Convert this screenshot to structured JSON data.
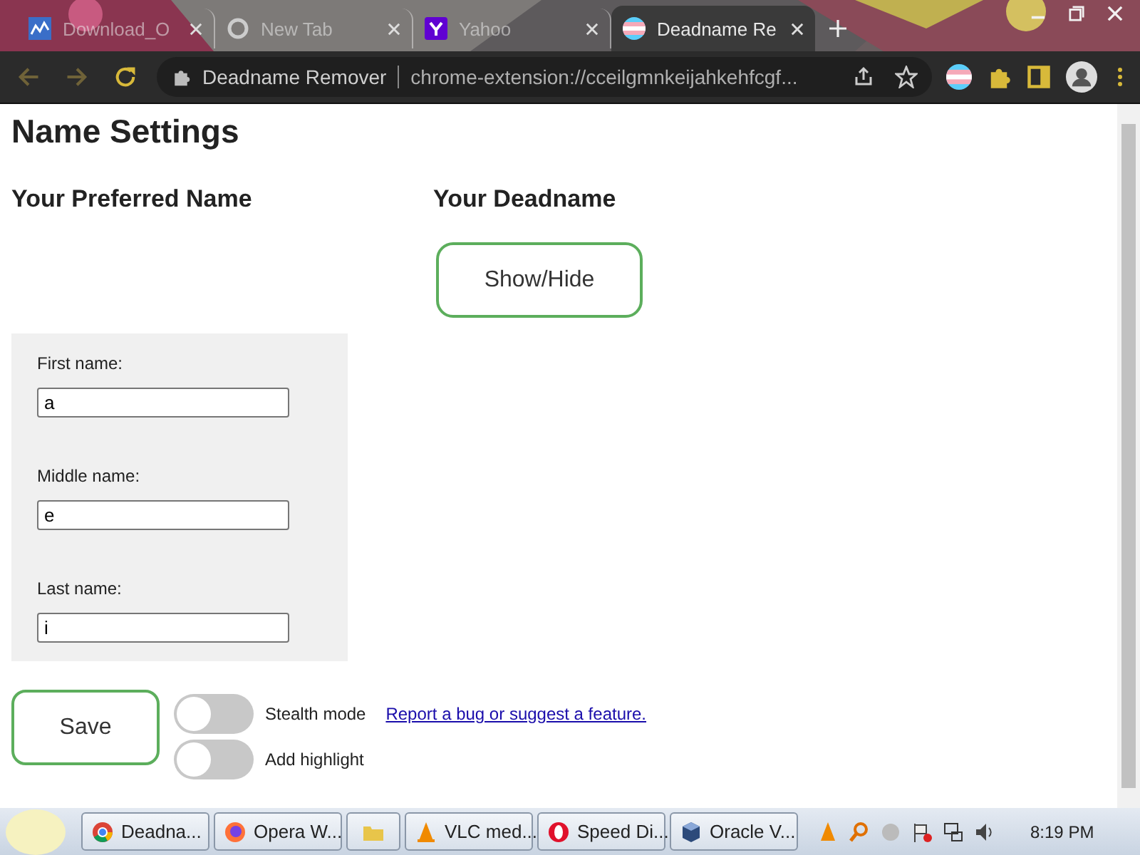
{
  "browser": {
    "tabs": [
      {
        "title": "Download_O",
        "kind": "chart",
        "selected": false
      },
      {
        "title": "New Tab",
        "kind": "google",
        "selected": false
      },
      {
        "title": "Yahoo",
        "kind": "yahoo",
        "selected": false
      },
      {
        "title": "Deadname Re",
        "kind": "flag",
        "selected": true
      }
    ],
    "site_name": "Deadname Remover",
    "url": "chrome-extension://cceilgmnkeijahkehfcgf..."
  },
  "page": {
    "title": "Name Settings",
    "preferred_heading": "Your Preferred Name",
    "deadname_heading": "Your Deadname",
    "show_hide_button": "Show/Hide",
    "fields": [
      {
        "label": "First name:",
        "value": "a"
      },
      {
        "label": "Middle name:",
        "value": "e"
      },
      {
        "label": "Last name:",
        "value": "i"
      }
    ],
    "save_button": "Save",
    "toggles": [
      {
        "label": "Stealth mode",
        "on": false
      },
      {
        "label": "Add highlight",
        "on": false
      }
    ],
    "report_link": "Report a bug or suggest a feature."
  },
  "taskbar": {
    "items": [
      {
        "label": "Deadna...",
        "kind": "chrome"
      },
      {
        "label": "Opera W...",
        "kind": "firefox"
      },
      {
        "kind": "folder"
      },
      {
        "label": "VLC med...",
        "kind": "vlc"
      },
      {
        "label": "Speed Di...",
        "kind": "opera"
      },
      {
        "label": "Oracle V...",
        "kind": "box"
      }
    ],
    "clock": "8:19 PM"
  }
}
